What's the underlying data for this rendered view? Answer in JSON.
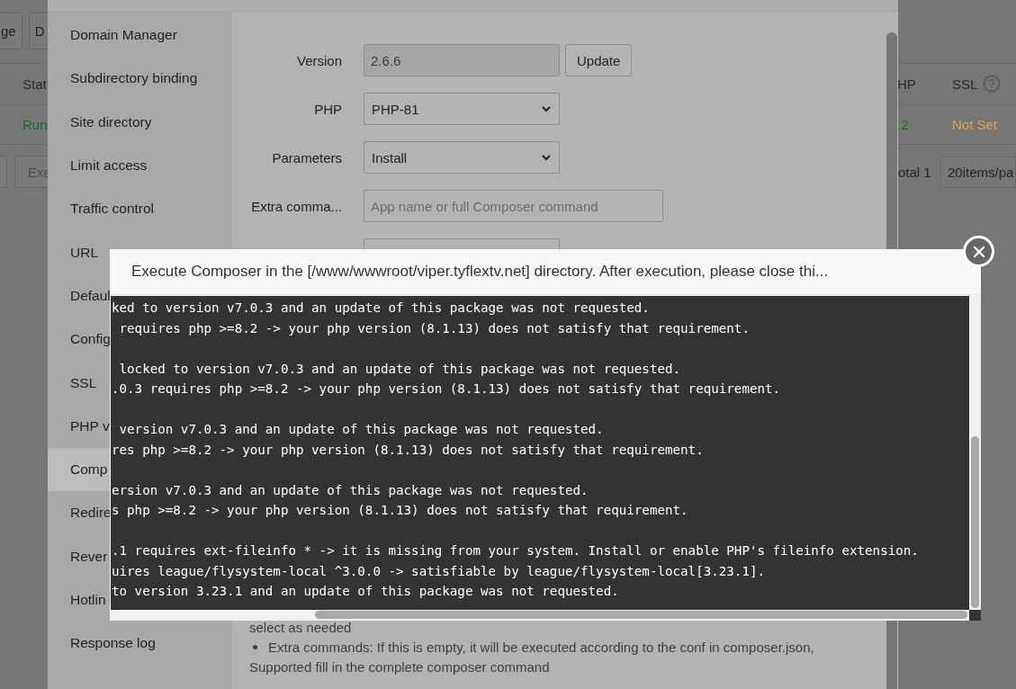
{
  "page": {
    "toolbar_buttons": [
      "ge",
      "D"
    ],
    "table": {
      "left_column": "Stat",
      "right_columns": [
        {
          "label": "HP",
          "help": false
        },
        {
          "label": "SSL",
          "help": true
        }
      ],
      "row": {
        "left": {
          "text": "Run",
          "color": "#1d6b2c"
        },
        "right": [
          {
            "text": ".2",
            "color": "#1d6b2c"
          },
          {
            "text": "Not Set",
            "color": "#e0a24a"
          }
        ]
      }
    },
    "pager": {
      "buttons": [
        "Exe"
      ],
      "total": "otal 1",
      "page_size": "20items/pa"
    }
  },
  "settings": {
    "sidebar": [
      {
        "label": "Domain Manager",
        "selected": false
      },
      {
        "label": "Subdirectory binding",
        "selected": false
      },
      {
        "label": "Site directory",
        "selected": false
      },
      {
        "label": "Limit access",
        "selected": false
      },
      {
        "label": "Traffic control",
        "selected": false
      },
      {
        "label": "URL",
        "selected": false
      },
      {
        "label": "Defaul",
        "selected": false
      },
      {
        "label": "Config",
        "selected": false
      },
      {
        "label": "SSL",
        "selected": false
      },
      {
        "label": "PHP v",
        "selected": false
      },
      {
        "label": "Comp",
        "selected": true
      },
      {
        "label": "Redire",
        "selected": false
      },
      {
        "label": "Rever",
        "selected": false
      },
      {
        "label": "Hotlin",
        "selected": false
      },
      {
        "label": "Response log",
        "selected": false
      }
    ],
    "form": [
      {
        "kind": "input",
        "label": "Version",
        "value": "2.6.6",
        "disabled": true,
        "button": "Update"
      },
      {
        "kind": "select",
        "label": "PHP",
        "value": "PHP-81"
      },
      {
        "kind": "select",
        "label": "Parameters",
        "value": "Install"
      },
      {
        "kind": "input",
        "label": "Extra comma...",
        "placeholder": "App name or full Composer command",
        "disabled": false
      },
      {
        "kind": "input",
        "disabled": false
      }
    ],
    "help": [
      {
        "kind": "text",
        "text": "select as needed"
      },
      {
        "kind": "bullet",
        "text": "Extra commands: If this is empty, it will be executed according to the conf in composer.json,"
      },
      {
        "kind": "text",
        "text": "Supported fill in the complete composer command"
      }
    ]
  },
  "console": {
    "title": "Execute Composer in the [/www/wwwroot/viper.tyflextv.net] directory. After execution, please close thi...",
    "blocks": [
      [
        "ked to version v7.0.3 and an update of this package was not requested.",
        " requires php >=8.2 -> your php version (8.1.13) does not satisfy that requirement."
      ],
      [
        " locked to version v7.0.3 and an update of this package was not requested.",
        ".0.3 requires php >=8.2 -> your php version (8.1.13) does not satisfy that requirement."
      ],
      [
        " version v7.0.3 and an update of this package was not requested.",
        "res php >=8.2 -> your php version (8.1.13) does not satisfy that requirement."
      ],
      [
        "ersion v7.0.3 and an update of this package was not requested.",
        "s php >=8.2 -> your php version (8.1.13) does not satisfy that requirement."
      ],
      [
        ".1 requires ext-fileinfo * -> it is missing from your system. Install or enable PHP's fileinfo extension.",
        "uires league/flysystem-local ^3.0.0 -> satisfiable by league/flysystem-local[3.23.1].",
        "to version 3.23.1 and an update of this package was not requested."
      ]
    ]
  }
}
